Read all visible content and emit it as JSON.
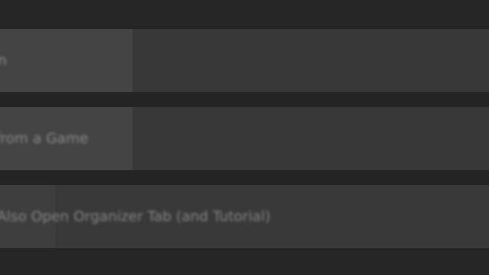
{
  "rows": [
    {
      "label": "en"
    },
    {
      "label": "from a Game"
    },
    {
      "label": "Also Open Organizer Tab (and Tutorial)"
    }
  ],
  "footer": {
    "text": ""
  }
}
